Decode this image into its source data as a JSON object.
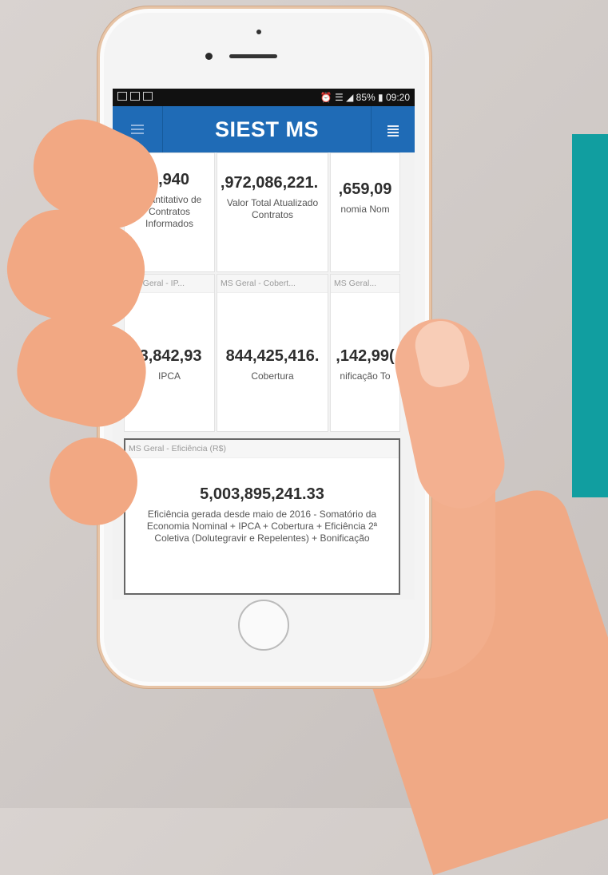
{
  "statusbar": {
    "right": "⏰ ☰ ◢ 85% ▮ 09:20"
  },
  "app": {
    "title": "SIEST MS"
  },
  "row1": [
    {
      "value": "1,940",
      "label": "Quantitativo de Contratos Informados"
    },
    {
      "value": ",972,086,221.",
      "label": "Valor Total Atualizado Contratos"
    },
    {
      "value": ",659,09",
      "label": "nomia Nom"
    }
  ],
  "row2": [
    {
      "header": "MS Geral - IP...",
      "value": "53,842,93",
      "label": "IPCA"
    },
    {
      "header": "MS Geral - Cobert...",
      "value": "844,425,416.",
      "label": "Cobertura"
    },
    {
      "header": "MS Geral...",
      "value": ",142,99(",
      "label": "nificação To"
    }
  ],
  "efficiency": {
    "header": "MS Geral - Eficiência (R$)",
    "value": "5,003,895,241.33",
    "label": "Eficiência gerada desde maio de 2016 - Somatório da Economia Nominal + IPCA + Cobertura + Eficiência 2ª Coletiva (Dolutegravir e Repelentes) + Bonificação"
  },
  "colors": {
    "appbar": "#1f6bb6",
    "accent": "#119ea0"
  }
}
